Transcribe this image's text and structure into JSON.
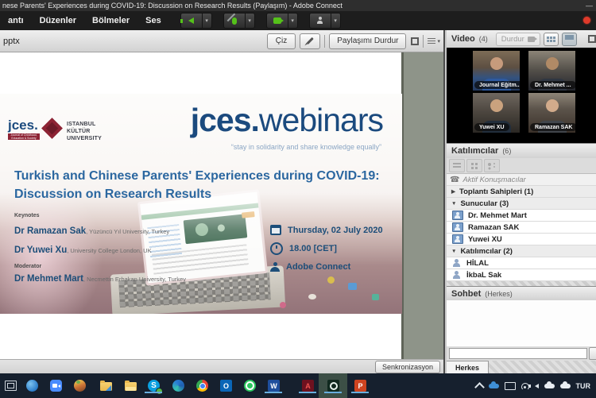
{
  "window": {
    "title": "nese Parents' Experiences during COVID-19: Discussion on Research Results (Paylaşım) - Adobe Connect"
  },
  "menu": {
    "items": [
      "antı",
      "Düzenler",
      "Bölmeler",
      "Ses"
    ]
  },
  "share": {
    "filename": "pptx",
    "draw": "Çiz",
    "stop": "Paylaşımı Durdur",
    "sync": "Senkronizasyon"
  },
  "slide": {
    "jces_logo": "jces.",
    "jces_logo_sub": "Journal of Childhood, Education & Society",
    "univ_line1": "ISTANBUL",
    "univ_line2": "KÜLTÜR",
    "univ_line3": "UNIVERSITY",
    "brand_bold": "jces.",
    "brand_light": "webinars",
    "tagline": "“stay in solidarity and share knowledge equally”",
    "heading1": "Turkish and Chinese Parents' Experiences during COVID-19:",
    "heading2": "Discussion on Research Results",
    "keynotes_label": "Keynotes",
    "keynote1_name": "Dr Ramazan Sak",
    "keynote1_affiliation": ", Yüzüncü Yıl University, Turkey",
    "keynote2_name": "Dr Yuwei Xu",
    "keynote2_affiliation": ", University College London, UK",
    "moderator_label": "Moderator",
    "moderator_name": "Dr Mehmet Mart",
    "moderator_affiliation": ", Necmettin Erbakan University, Turkey",
    "date": "Thursday, 02 July 2020",
    "time": "18.00 [CET]",
    "platform": "Adobe Connect"
  },
  "video": {
    "title": "Video",
    "count": "(4)",
    "stop": "Durdur",
    "tiles": [
      {
        "name": "Journal Eğitm..."
      },
      {
        "name": "Dr. Mehmet ..."
      },
      {
        "name": "Yuwei XU"
      },
      {
        "name": "Ramazan SAK"
      }
    ]
  },
  "participants": {
    "title": "Katılımcılar",
    "count": "(6)",
    "rows": [
      {
        "label": "Aktif Konuşmacılar"
      },
      {
        "label": "Toplantı Sahipleri (1)"
      },
      {
        "label": "Sunucular (3)"
      },
      {
        "label": "Dr. Mehmet Mart"
      },
      {
        "label": "Ramazan SAK"
      },
      {
        "label": "Yuwei XU"
      },
      {
        "label": "Katılımcılar (2)"
      },
      {
        "label": "HİLAL"
      },
      {
        "label": "İkbaL Sak"
      }
    ]
  },
  "chat": {
    "title": "Sohbet",
    "scope": "(Herkes)",
    "tab": "Herkes"
  },
  "taskbar": {
    "language": "TUR",
    "glyphs": {
      "skype": "S",
      "outlook": "O",
      "word": "W",
      "acrobat": "A",
      "powerpoint": "P"
    }
  },
  "icons": {
    "collapsed": "▶",
    "expanded": "▼",
    "phone": "☎",
    "dropdown": "▾",
    "minimize": "—"
  },
  "colors": {
    "accent_navy": "#1b4a7e",
    "heading_blue": "#2b67a0",
    "record_red": "#e03a2a",
    "taskbar_bg": "#16202e"
  }
}
